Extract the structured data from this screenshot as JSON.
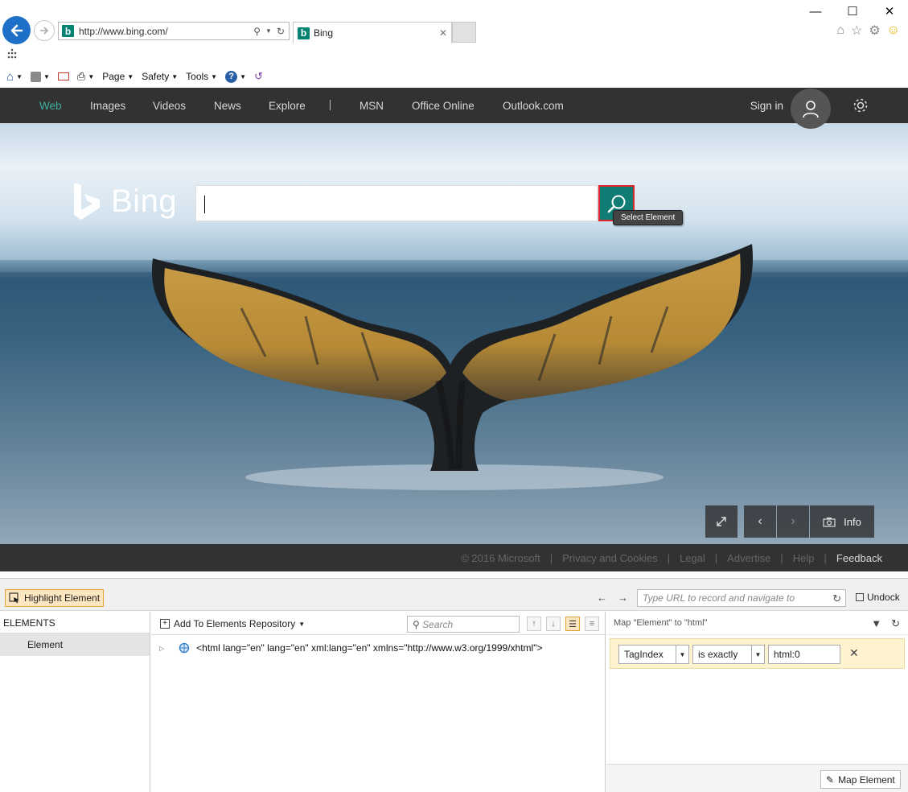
{
  "browser": {
    "address_url": "http://www.bing.com/",
    "tab_title": "Bing",
    "command_bar": {
      "page_label": "Page",
      "safety_label": "Safety",
      "tools_label": "Tools"
    }
  },
  "bing": {
    "nav_items": [
      "Web",
      "Images",
      "Videos",
      "News",
      "Explore",
      "MSN",
      "Office Online",
      "Outlook.com"
    ],
    "sign_in_label": "Sign in",
    "logo_text": "Bing",
    "search_value": "",
    "tooltip": "Select Element",
    "info_label": "Info",
    "footer": {
      "copyright": "© 2016 Microsoft",
      "privacy": "Privacy and Cookies",
      "legal": "Legal",
      "advertise": "Advertise",
      "help": "Help",
      "feedback": "Feedback"
    },
    "colors": {
      "accent": "#0f7d74",
      "nav_active": "#3fb0a3",
      "header_bg": "#323232",
      "highlight_border": "#e0262b"
    }
  },
  "tool": {
    "highlight_label": "Highlight Element",
    "record_url_placeholder": "Type URL to record and navigate to",
    "undock_label": "Undock",
    "elements_title": "ELEMENTS",
    "elements_items": [
      "Element"
    ],
    "add_repo_label": "Add To Elements Repository",
    "search_placeholder": "Search",
    "tree_node": "<html lang=\"en\" lang=\"en\" xml:lang=\"en\" xmlns=\"http://www.w3.org/1999/xhtml\">",
    "map_title": "Map \"Element\" to \"html\"",
    "filter": {
      "property": "TagIndex",
      "operator": "is exactly",
      "value": "html:0"
    },
    "map_button_label": "Map Element"
  }
}
